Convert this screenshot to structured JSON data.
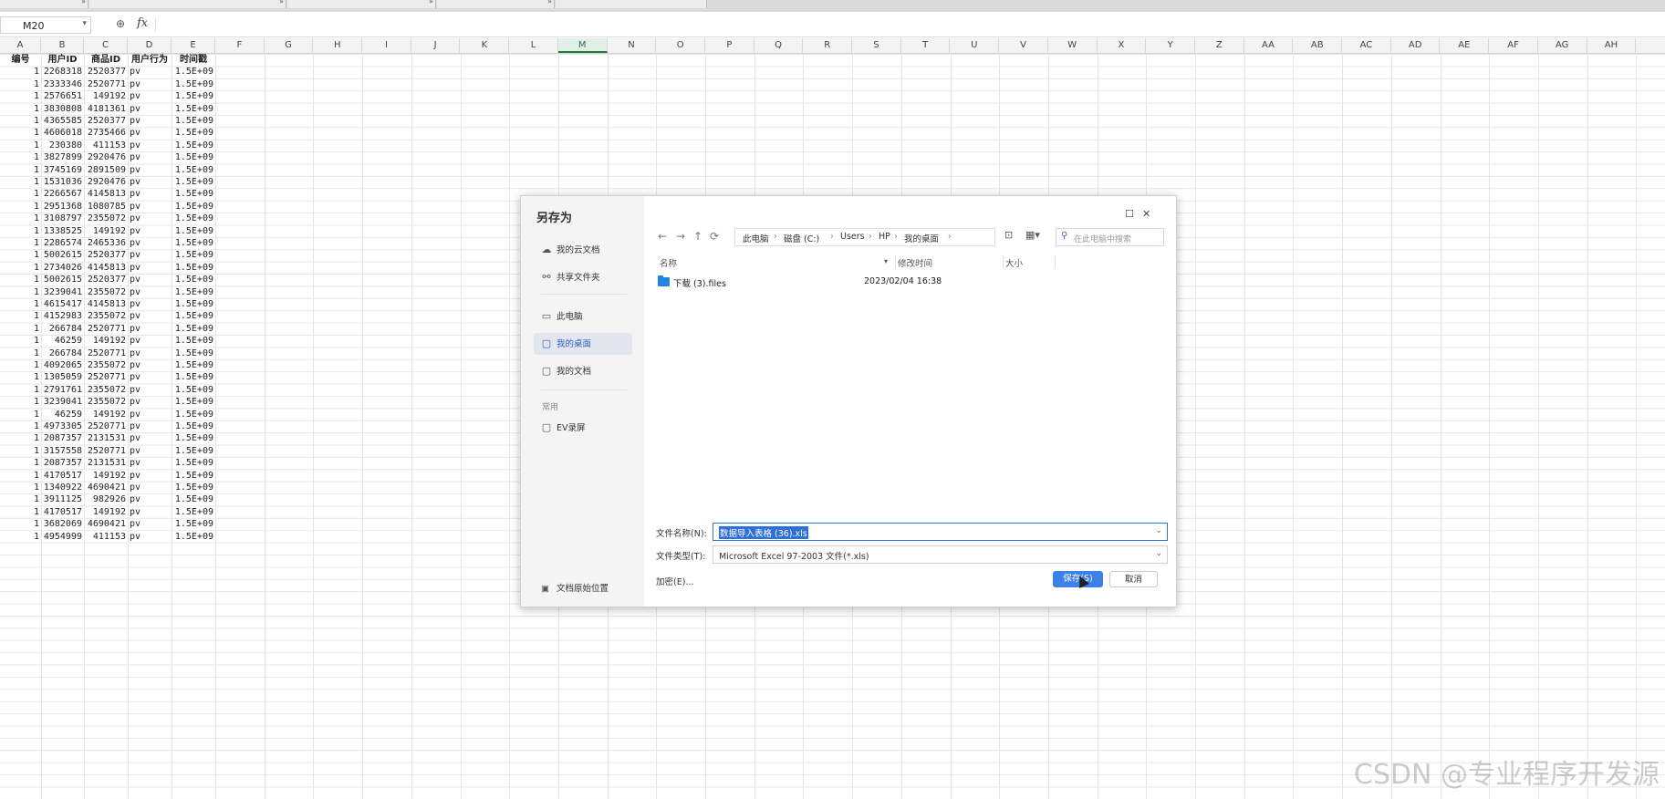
{
  "namebox": {
    "value": "M20",
    "chevron": "▾"
  },
  "formula": {
    "zoom_icon": "zoom-icon",
    "fx": "fx"
  },
  "columns": [
    "A",
    "B",
    "C",
    "D",
    "E",
    "F",
    "G",
    "H",
    "I",
    "J",
    "K",
    "L",
    "M",
    "N",
    "O",
    "P",
    "Q",
    "R",
    "S",
    "T",
    "U",
    "V",
    "W",
    "X",
    "Y",
    "Z",
    "AA",
    "AB",
    "AC",
    "AD",
    "AE",
    "AF",
    "AG",
    "AH"
  ],
  "selected_column": "M",
  "header_row": [
    "编号",
    "用户ID",
    "商品ID",
    "用户行为",
    "时间戳"
  ],
  "rows": [
    [
      "1",
      "2268318",
      "2520377",
      "pv",
      "1.5E+09"
    ],
    [
      "1",
      "2333346",
      "2520771",
      "pv",
      "1.5E+09"
    ],
    [
      "1",
      "2576651",
      "149192",
      "pv",
      "1.5E+09"
    ],
    [
      "1",
      "3830808",
      "4181361",
      "pv",
      "1.5E+09"
    ],
    [
      "1",
      "4365585",
      "2520377",
      "pv",
      "1.5E+09"
    ],
    [
      "1",
      "4606018",
      "2735466",
      "pv",
      "1.5E+09"
    ],
    [
      "1",
      "230380",
      "411153",
      "pv",
      "1.5E+09"
    ],
    [
      "1",
      "3827899",
      "2920476",
      "pv",
      "1.5E+09"
    ],
    [
      "1",
      "3745169",
      "2891509",
      "pv",
      "1.5E+09"
    ],
    [
      "1",
      "1531036",
      "2920476",
      "pv",
      "1.5E+09"
    ],
    [
      "1",
      "2266567",
      "4145813",
      "pv",
      "1.5E+09"
    ],
    [
      "1",
      "2951368",
      "1080785",
      "pv",
      "1.5E+09"
    ],
    [
      "1",
      "3108797",
      "2355072",
      "pv",
      "1.5E+09"
    ],
    [
      "1",
      "1338525",
      "149192",
      "pv",
      "1.5E+09"
    ],
    [
      "1",
      "2286574",
      "2465336",
      "pv",
      "1.5E+09"
    ],
    [
      "1",
      "5002615",
      "2520377",
      "pv",
      "1.5E+09"
    ],
    [
      "1",
      "2734026",
      "4145813",
      "pv",
      "1.5E+09"
    ],
    [
      "1",
      "5002615",
      "2520377",
      "pv",
      "1.5E+09"
    ],
    [
      "1",
      "3239041",
      "2355072",
      "pv",
      "1.5E+09"
    ],
    [
      "1",
      "4615417",
      "4145813",
      "pv",
      "1.5E+09"
    ],
    [
      "1",
      "4152983",
      "2355072",
      "pv",
      "1.5E+09"
    ],
    [
      "1",
      "266784",
      "2520771",
      "pv",
      "1.5E+09"
    ],
    [
      "1",
      "46259",
      "149192",
      "pv",
      "1.5E+09"
    ],
    [
      "1",
      "266784",
      "2520771",
      "pv",
      "1.5E+09"
    ],
    [
      "1",
      "4092065",
      "2355072",
      "pv",
      "1.5E+09"
    ],
    [
      "1",
      "1305059",
      "2520771",
      "pv",
      "1.5E+09"
    ],
    [
      "1",
      "2791761",
      "2355072",
      "pv",
      "1.5E+09"
    ],
    [
      "1",
      "3239041",
      "2355072",
      "pv",
      "1.5E+09"
    ],
    [
      "1",
      "46259",
      "149192",
      "pv",
      "1.5E+09"
    ],
    [
      "1",
      "4973305",
      "2520771",
      "pv",
      "1.5E+09"
    ],
    [
      "1",
      "2087357",
      "2131531",
      "pv",
      "1.5E+09"
    ],
    [
      "1",
      "3157558",
      "2520771",
      "pv",
      "1.5E+09"
    ],
    [
      "1",
      "2087357",
      "2131531",
      "pv",
      "1.5E+09"
    ],
    [
      "1",
      "4170517",
      "149192",
      "pv",
      "1.5E+09"
    ],
    [
      "1",
      "1340922",
      "4690421",
      "pv",
      "1.5E+09"
    ],
    [
      "1",
      "3911125",
      "982926",
      "pv",
      "1.5E+09"
    ],
    [
      "1",
      "4170517",
      "149192",
      "pv",
      "1.5E+09"
    ],
    [
      "1",
      "3682069",
      "4690421",
      "pv",
      "1.5E+09"
    ],
    [
      "1",
      "4954999",
      "411153",
      "pv",
      "1.5E+09"
    ]
  ],
  "dialog": {
    "title": "另存为",
    "sidebar": [
      {
        "label": "我的云文档",
        "icon": "cloud-icon"
      },
      {
        "label": "共享文件夹",
        "icon": "share-icon"
      },
      {
        "label": "此电脑",
        "icon": "monitor-icon"
      },
      {
        "label": "我的桌面",
        "icon": "folder-icon",
        "active": true
      },
      {
        "label": "我的文档",
        "icon": "folder-icon"
      }
    ],
    "group_label": "常用",
    "group_items": [
      {
        "label": "EV录屏",
        "icon": "folder-icon"
      }
    ],
    "location_label": "文档原始位置",
    "path": [
      "此电脑",
      "磁盘 (C:)",
      "Users",
      "HP",
      "我的桌面"
    ],
    "search_placeholder": "在此电脑中搜索",
    "list_headers": {
      "name": "名称",
      "modified": "修改时间",
      "size": "大小"
    },
    "files": [
      {
        "name": "下载 (3).files",
        "modified": "2023/02/04 16:38",
        "type": "folder"
      }
    ],
    "filename_label": "文件名称(N):",
    "filename_value": "数据导入表格 (36).xls",
    "filetype_label": "文件类型(T):",
    "filetype_value": "Microsoft Excel 97-2003 文件(*.xls)",
    "encrypt_label": "加密(E)...",
    "save_label": "保存(S)",
    "cancel_label": "取消"
  },
  "watermark": "CSDN @专业程序开发源"
}
